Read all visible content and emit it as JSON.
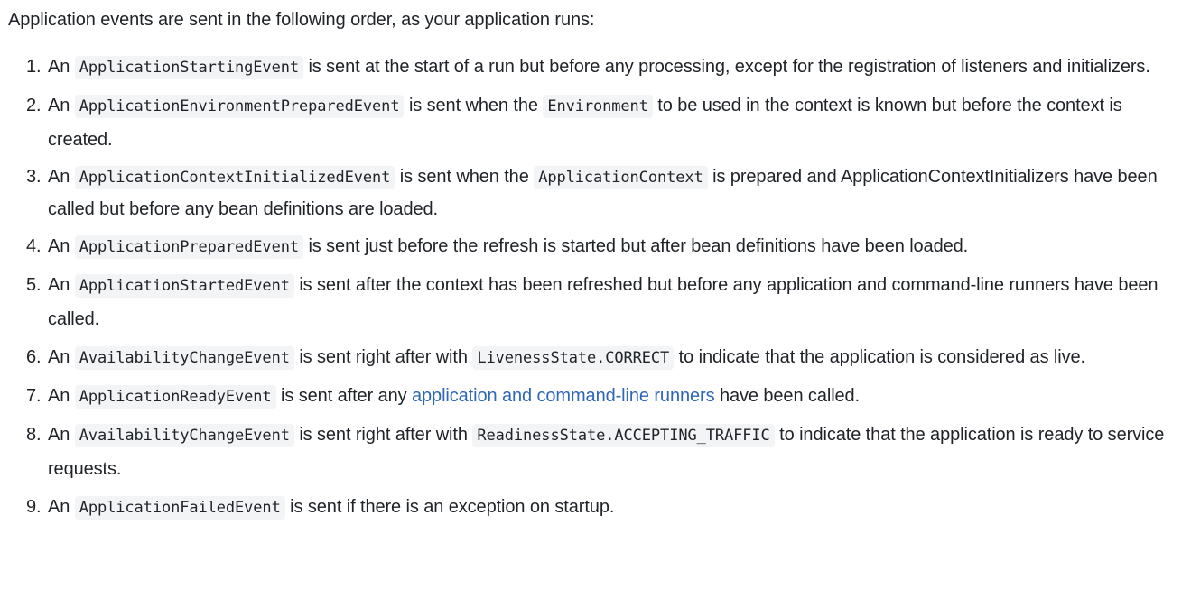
{
  "intro": "Application events are sent in the following order, as your application runs:",
  "events": [
    {
      "num": "1.",
      "pre": "An",
      "code1": "ApplicationStartingEvent",
      "text1": "is sent at the start of a run but before any processing, except for the registration of listeners and initializers."
    },
    {
      "num": "2.",
      "pre": "An",
      "code1": "ApplicationEnvironmentPreparedEvent",
      "text1": "is sent when the",
      "code2": "Environment",
      "text2": "to be used in the context is known but before the context is created."
    },
    {
      "num": "3.",
      "pre": "An",
      "code1": "ApplicationContextInitializedEvent",
      "text1": "is sent when the",
      "code2": "ApplicationContext",
      "text2": "is prepared and ApplicationContextInitializers have been called but before any bean definitions are loaded."
    },
    {
      "num": "4.",
      "pre": "An",
      "code1": "ApplicationPreparedEvent",
      "text1": "is sent just before the refresh is started but after bean definitions have been loaded."
    },
    {
      "num": "5.",
      "pre": "An",
      "code1": "ApplicationStartedEvent",
      "text1": "is sent after the context has been refreshed but before any application and command-line runners have been called."
    },
    {
      "num": "6.",
      "pre": "An",
      "code1": "AvailabilityChangeEvent",
      "text1": "is sent right after with",
      "code2": "LivenessState.CORRECT",
      "text2": "to indicate that the application is considered as live."
    },
    {
      "num": "7.",
      "pre": "An",
      "code1": "ApplicationReadyEvent",
      "text1": "is sent after any",
      "link": "application and command-line runners",
      "text2": "have been called."
    },
    {
      "num": "8.",
      "pre": "An",
      "code1": "AvailabilityChangeEvent",
      "text1": "is sent right after with",
      "code2": "ReadinessState.ACCEPTING_TRAFFIC",
      "text2": "to indicate that the application is ready to service requests."
    },
    {
      "num": "9.",
      "pre": "An",
      "code1": "ApplicationFailedEvent",
      "text1": "is sent if there is an exception on startup."
    }
  ]
}
